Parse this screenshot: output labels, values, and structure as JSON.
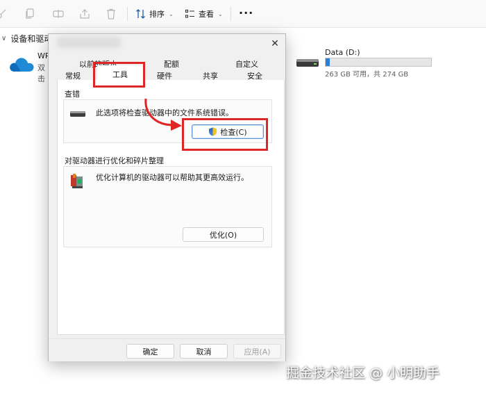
{
  "toolbar": {
    "sort_label": "排序",
    "view_label": "查看",
    "more_label": "···"
  },
  "explorer": {
    "section_label": "设备和驱动器",
    "cloud": {
      "name": "WP",
      "sub": "双击"
    },
    "drive": {
      "name": "Data (D:)",
      "free_text": "263 GB 可用，共 274 GB",
      "used_fraction": 0.04
    }
  },
  "dialog": {
    "close_glyph": "✕",
    "tabs_row1": [
      "以前的版本",
      "配额",
      "自定义"
    ],
    "tabs_row2": [
      "常规",
      "工具",
      "硬件",
      "共享",
      "安全"
    ],
    "active_tab": "工具",
    "error_check": {
      "title": "查错",
      "description": "此选项将检查驱动器中的文件系统错误。",
      "button_label": "检查(C)"
    },
    "optimize": {
      "title": "对驱动器进行优化和碎片整理",
      "description": "优化计算机的驱动器可以帮助其更高效运行。",
      "button_label": "优化(O)"
    },
    "footer": {
      "ok_label": "确定",
      "cancel_label": "取消",
      "apply_label": "应用(A)"
    }
  },
  "annotation": {
    "color": "#e02525"
  },
  "watermark": "掘金技术社区 @ 小明助手"
}
